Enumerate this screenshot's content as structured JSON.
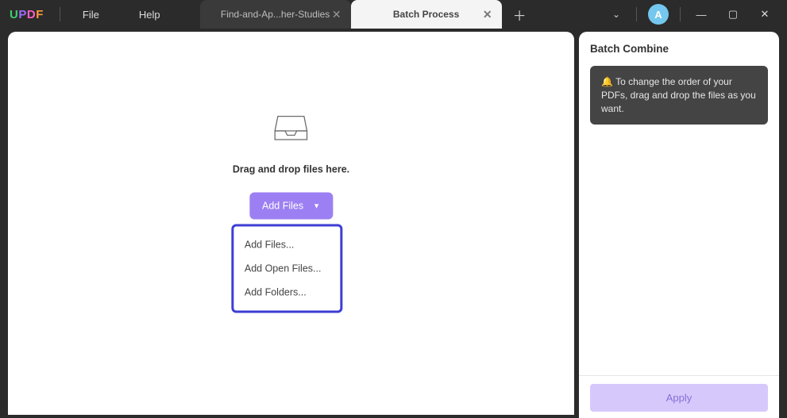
{
  "app": {
    "logo_chars": [
      "U",
      "P",
      "D",
      "F"
    ]
  },
  "menu": {
    "file": "File",
    "help": "Help"
  },
  "tabs": {
    "inactive_title": "Find-and-Ap...her-Studies",
    "active_title": "Batch Process"
  },
  "avatar_initial": "A",
  "dropzone": {
    "text": "Drag and drop files here.",
    "button": "Add Files",
    "menu": {
      "files": "Add Files...",
      "open_files": "Add Open Files...",
      "folders": "Add Folders..."
    }
  },
  "sidebar": {
    "title": "Batch Combine",
    "tip_icon": "🔔",
    "tip_text": "To change the order of your PDFs, drag and drop the files as you want.",
    "apply": "Apply"
  }
}
